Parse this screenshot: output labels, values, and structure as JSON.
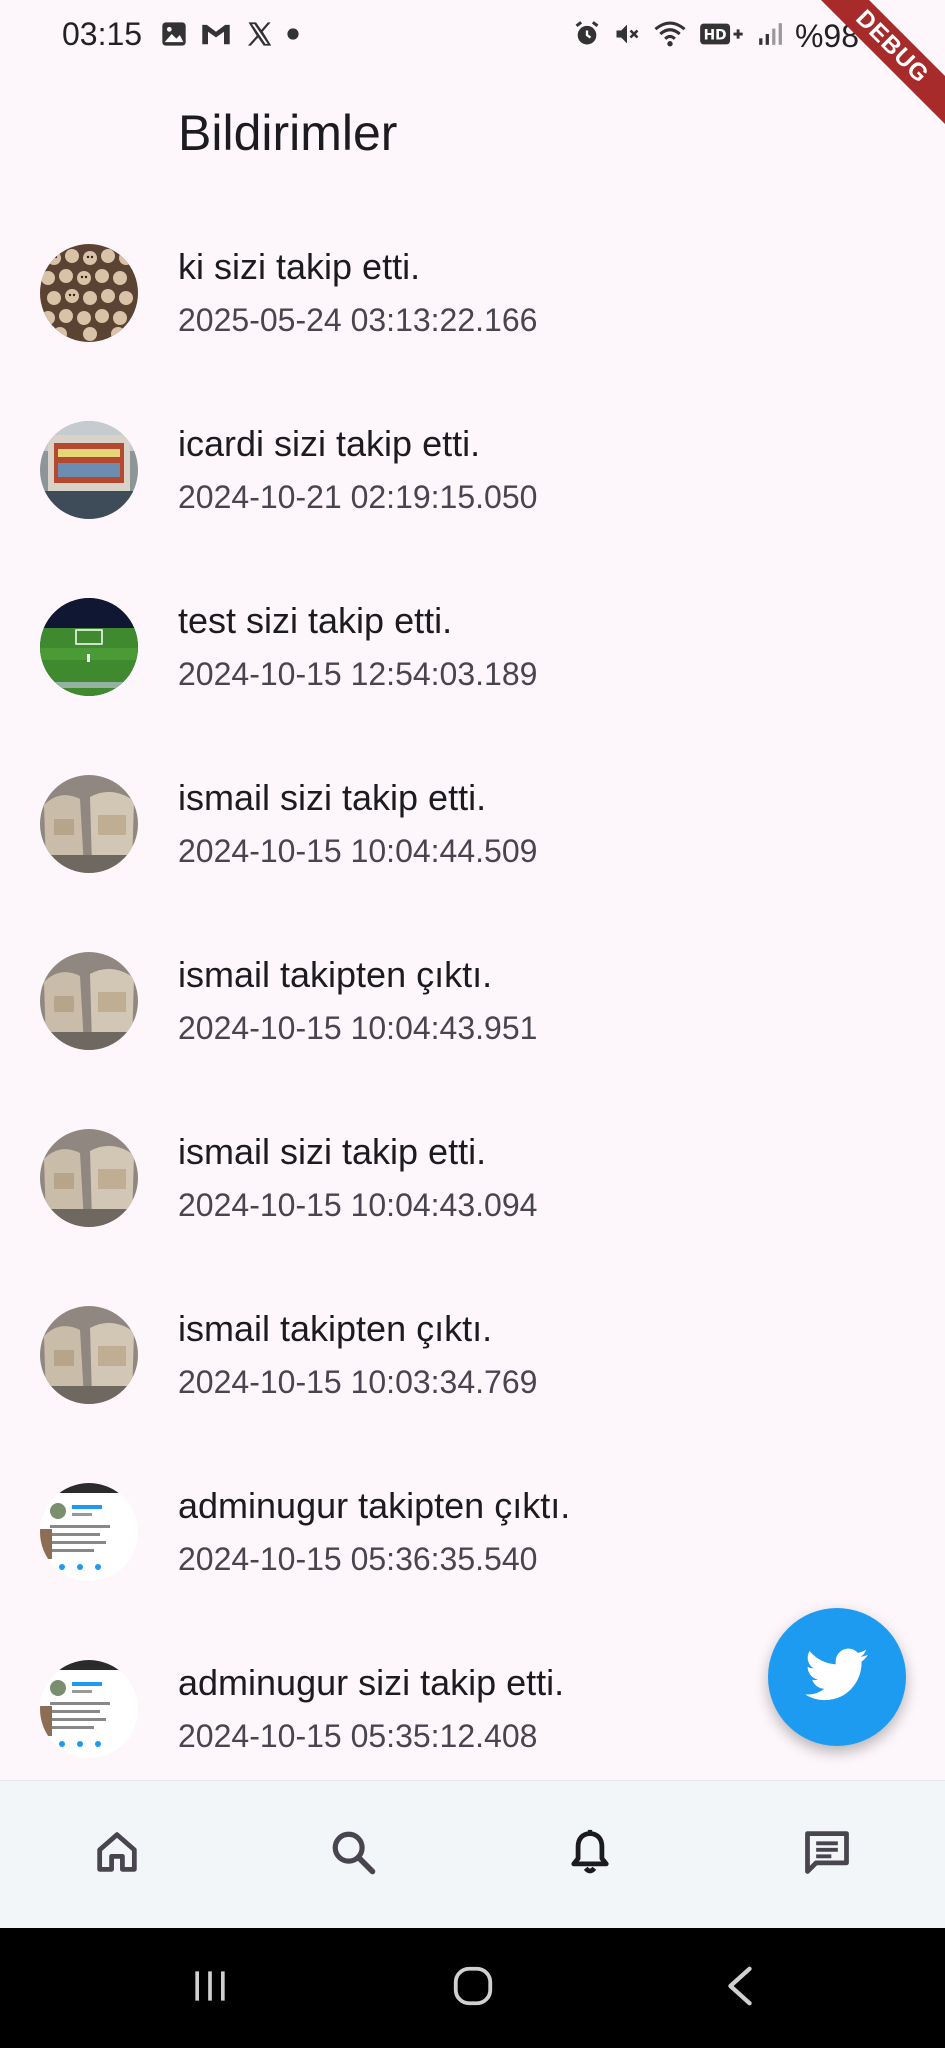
{
  "status_bar": {
    "time": "03:15",
    "battery": "%98",
    "left_icons": [
      "image-icon",
      "gmail-icon",
      "x-icon",
      "dot-icon"
    ],
    "right_icons": [
      "alarm-icon",
      "mute-icon",
      "wifi-icon",
      "hd-icon",
      "signal-icon",
      "battery-icon"
    ]
  },
  "debug_banner": "DEBUG",
  "app_bar": {
    "title": "Bildirimler"
  },
  "notifications": [
    {
      "title": "ki sizi takip etti.",
      "timestamp": "2025-05-24 03:13:22.166",
      "avatar": "crowd-photo"
    },
    {
      "title": "icardi sizi takip etti.",
      "timestamp": "2024-10-21 02:19:15.050",
      "avatar": "shop-photo"
    },
    {
      "title": "test sizi takip etti.",
      "timestamp": "2024-10-15 12:54:03.189",
      "avatar": "football-field-photo"
    },
    {
      "title": "ismail sizi takip etti.",
      "timestamp": "2024-10-15 10:04:44.509",
      "avatar": "bags-photo"
    },
    {
      "title": "ismail takipten çıktı.",
      "timestamp": "2024-10-15 10:04:43.951",
      "avatar": "bags-photo"
    },
    {
      "title": "ismail sizi takip etti.",
      "timestamp": "2024-10-15 10:04:43.094",
      "avatar": "bags-photo"
    },
    {
      "title": "ismail takipten çıktı.",
      "timestamp": "2024-10-15 10:03:34.769",
      "avatar": "bags-photo"
    },
    {
      "title": "adminugur takipten çıktı.",
      "timestamp": "2024-10-15 05:36:35.540",
      "avatar": "screenshot-photo"
    },
    {
      "title": "adminugur sizi takip etti.",
      "timestamp": "2024-10-15 05:35:12.408",
      "avatar": "screenshot-photo"
    }
  ],
  "fab": {
    "icon": "bird-icon",
    "color": "#1d9bf0"
  },
  "bottom_nav": {
    "items": [
      {
        "icon": "home-icon",
        "active": false
      },
      {
        "icon": "search-icon",
        "active": false
      },
      {
        "icon": "bell-icon",
        "active": true
      },
      {
        "icon": "message-icon",
        "active": false
      }
    ]
  },
  "system_nav": {
    "items": [
      "recents-icon",
      "home-circle-icon",
      "back-icon"
    ]
  },
  "colors": {
    "background": "#fdf7fc",
    "accent": "#1d9bf0",
    "debug": "#a72b2b"
  }
}
